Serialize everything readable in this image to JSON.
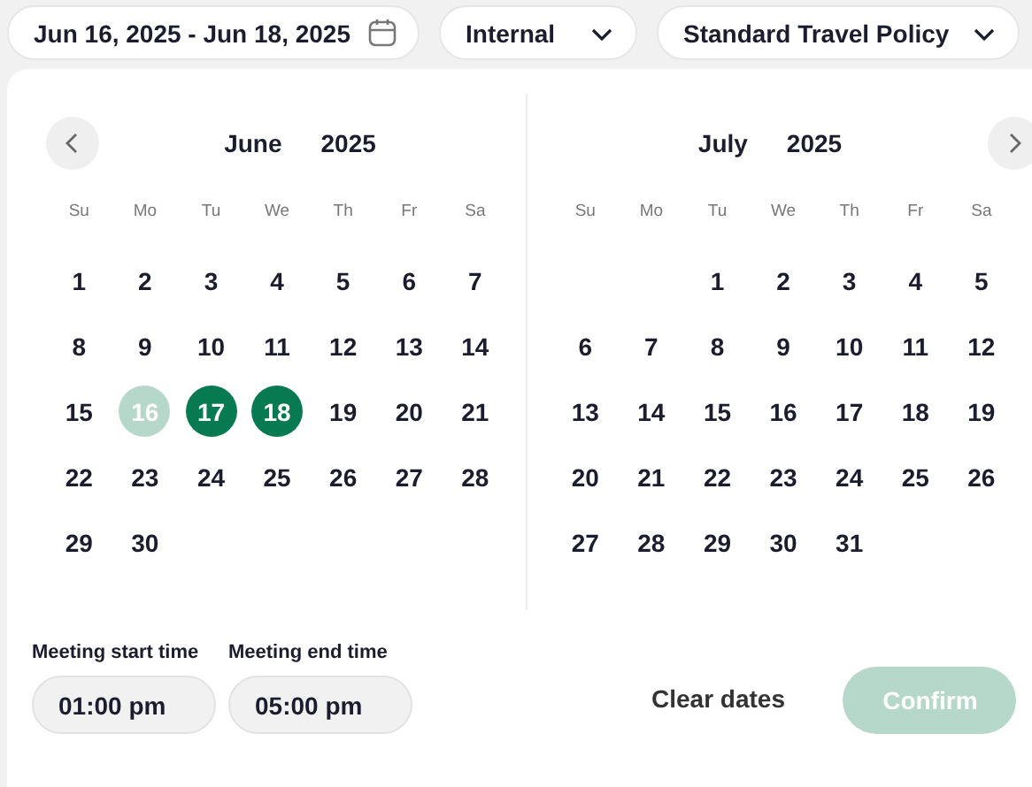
{
  "filters": [
    {
      "kind": "date",
      "value": "Jun 16, 2025 - Jun 18, 2025"
    },
    {
      "kind": "select",
      "value": "Internal"
    },
    {
      "kind": "select",
      "value": "Standard Travel Policy"
    }
  ],
  "calendar": {
    "months": [
      {
        "name": "June",
        "year": "2025",
        "nav_prev": true,
        "nav_next": false,
        "weekdays": [
          "Su",
          "Mo",
          "Tu",
          "We",
          "Th",
          "Fr",
          "Sa"
        ],
        "weeks": [
          [
            {
              "kind": "day",
              "day": "1",
              "selected": false,
              "faded": false
            },
            {
              "kind": "day",
              "day": "2",
              "selected": false,
              "faded": false
            },
            {
              "kind": "day",
              "day": "3",
              "selected": false,
              "faded": false
            },
            {
              "kind": "day",
              "day": "4",
              "selected": false,
              "faded": false
            },
            {
              "kind": "day",
              "day": "5",
              "selected": false,
              "faded": false
            },
            {
              "kind": "day",
              "day": "6",
              "selected": false,
              "faded": false
            },
            {
              "kind": "day",
              "day": "7",
              "selected": false,
              "faded": false
            }
          ],
          [
            {
              "kind": "day",
              "day": "8",
              "selected": false,
              "faded": false
            },
            {
              "kind": "day",
              "day": "9",
              "selected": false,
              "faded": false
            },
            {
              "kind": "day",
              "day": "10",
              "selected": false,
              "faded": false
            },
            {
              "kind": "day",
              "day": "11",
              "selected": false,
              "faded": false
            },
            {
              "kind": "day",
              "day": "12",
              "selected": false,
              "faded": false
            },
            {
              "kind": "day",
              "day": "13",
              "selected": false,
              "faded": false
            },
            {
              "kind": "day",
              "day": "14",
              "selected": false,
              "faded": false
            }
          ],
          [
            {
              "kind": "day",
              "day": "15",
              "selected": false,
              "faded": false
            },
            {
              "kind": "day",
              "day": "16",
              "selected": true,
              "faded": true
            },
            {
              "kind": "day",
              "day": "17",
              "selected": true,
              "faded": false
            },
            {
              "kind": "day",
              "day": "18",
              "selected": true,
              "faded": false
            },
            {
              "kind": "day",
              "day": "19",
              "selected": false,
              "faded": false
            },
            {
              "kind": "day",
              "day": "20",
              "selected": false,
              "faded": false
            },
            {
              "kind": "day",
              "day": "21",
              "selected": false,
              "faded": false
            }
          ],
          [
            {
              "kind": "day",
              "day": "22",
              "selected": false,
              "faded": false
            },
            {
              "kind": "day",
              "day": "23",
              "selected": false,
              "faded": false
            },
            {
              "kind": "day",
              "day": "24",
              "selected": false,
              "faded": false
            },
            {
              "kind": "day",
              "day": "25",
              "selected": false,
              "faded": false
            },
            {
              "kind": "day",
              "day": "26",
              "selected": false,
              "faded": false
            },
            {
              "kind": "day",
              "day": "27",
              "selected": false,
              "faded": false
            },
            {
              "kind": "day",
              "day": "28",
              "selected": false,
              "faded": false
            }
          ],
          [
            {
              "kind": "day",
              "day": "29",
              "selected": false,
              "faded": false
            },
            {
              "kind": "day",
              "day": "30",
              "selected": false,
              "faded": false
            },
            {
              "kind": "blank"
            },
            {
              "kind": "blank"
            },
            {
              "kind": "blank"
            },
            {
              "kind": "blank"
            },
            {
              "kind": "blank"
            }
          ]
        ]
      },
      {
        "name": "July",
        "year": "2025",
        "nav_prev": false,
        "nav_next": true,
        "weekdays": [
          "Su",
          "Mo",
          "Tu",
          "We",
          "Th",
          "Fr",
          "Sa"
        ],
        "weeks": [
          [
            {
              "kind": "blank"
            },
            {
              "kind": "blank"
            },
            {
              "kind": "day",
              "day": "1",
              "selected": false,
              "faded": false
            },
            {
              "kind": "day",
              "day": "2",
              "selected": false,
              "faded": false
            },
            {
              "kind": "day",
              "day": "3",
              "selected": false,
              "faded": false
            },
            {
              "kind": "day",
              "day": "4",
              "selected": false,
              "faded": false
            },
            {
              "kind": "day",
              "day": "5",
              "selected": false,
              "faded": false
            }
          ],
          [
            {
              "kind": "day",
              "day": "6",
              "selected": false,
              "faded": false
            },
            {
              "kind": "day",
              "day": "7",
              "selected": false,
              "faded": false
            },
            {
              "kind": "day",
              "day": "8",
              "selected": false,
              "faded": false
            },
            {
              "kind": "day",
              "day": "9",
              "selected": false,
              "faded": false
            },
            {
              "kind": "day",
              "day": "10",
              "selected": false,
              "faded": false
            },
            {
              "kind": "day",
              "day": "11",
              "selected": false,
              "faded": false
            },
            {
              "kind": "day",
              "day": "12",
              "selected": false,
              "faded": false
            }
          ],
          [
            {
              "kind": "day",
              "day": "13",
              "selected": false,
              "faded": false
            },
            {
              "kind": "day",
              "day": "14",
              "selected": false,
              "faded": false
            },
            {
              "kind": "day",
              "day": "15",
              "selected": false,
              "faded": false
            },
            {
              "kind": "day",
              "day": "16",
              "selected": false,
              "faded": false
            },
            {
              "kind": "day",
              "day": "17",
              "selected": false,
              "faded": false
            },
            {
              "kind": "day",
              "day": "18",
              "selected": false,
              "faded": false
            },
            {
              "kind": "day",
              "day": "19",
              "selected": false,
              "faded": false
            }
          ],
          [
            {
              "kind": "day",
              "day": "20",
              "selected": false,
              "faded": false
            },
            {
              "kind": "day",
              "day": "21",
              "selected": false,
              "faded": false
            },
            {
              "kind": "day",
              "day": "22",
              "selected": false,
              "faded": false
            },
            {
              "kind": "day",
              "day": "23",
              "selected": false,
              "faded": false
            },
            {
              "kind": "day",
              "day": "24",
              "selected": false,
              "faded": false
            },
            {
              "kind": "day",
              "day": "25",
              "selected": false,
              "faded": false
            },
            {
              "kind": "day",
              "day": "26",
              "selected": false,
              "faded": false
            }
          ],
          [
            {
              "kind": "day",
              "day": "27",
              "selected": false,
              "faded": false
            },
            {
              "kind": "day",
              "day": "28",
              "selected": false,
              "faded": false
            },
            {
              "kind": "day",
              "day": "29",
              "selected": false,
              "faded": false
            },
            {
              "kind": "day",
              "day": "30",
              "selected": false,
              "faded": false
            },
            {
              "kind": "day",
              "day": "31",
              "selected": false,
              "faded": false
            },
            {
              "kind": "blank"
            },
            {
              "kind": "blank"
            }
          ]
        ]
      }
    ]
  },
  "times": [
    {
      "label": "Meeting start time",
      "value": "01:00 pm"
    },
    {
      "label": "Meeting end time",
      "value": "05:00 pm"
    }
  ],
  "actions": {
    "clear": "Clear dates",
    "confirm": {
      "label": "Confirm",
      "disabled": true
    }
  }
}
